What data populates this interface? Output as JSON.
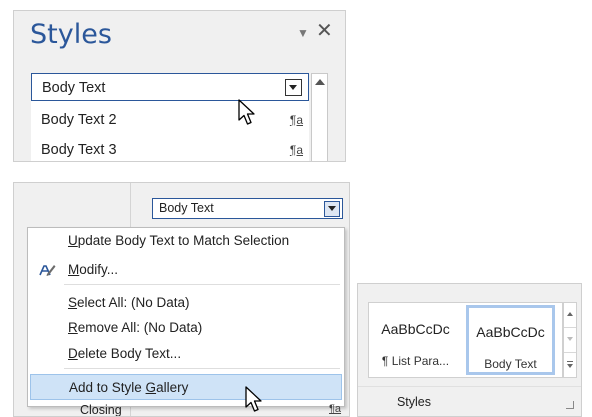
{
  "styles_pane": {
    "title": "Styles",
    "dropdown_glyph": "▼",
    "close_glyph": "✕",
    "items": [
      {
        "label": "Body Text",
        "mark": ""
      },
      {
        "label": "Body Text 2",
        "mark": "¶a"
      },
      {
        "label": "Body Text 3",
        "mark": "¶a"
      }
    ]
  },
  "context": {
    "combo_value": "Body Text",
    "menu": [
      {
        "pre": "",
        "u": "U",
        "post": "pdate Body Text to Match Selection"
      },
      {
        "pre": "",
        "u": "M",
        "post": "odify..."
      },
      {
        "pre": "",
        "u": "S",
        "post": "elect All: (No Data)"
      },
      {
        "pre": "",
        "u": "R",
        "post": "emove All: (No Data)"
      },
      {
        "pre": "",
        "u": "D",
        "post": "elete Body Text..."
      },
      {
        "pre": "Add to Style ",
        "u": "G",
        "post": "allery"
      }
    ],
    "below_item": "Closing",
    "below_mark": "¶a"
  },
  "gallery": {
    "items": [
      {
        "sample": "AaBbCcDc",
        "name": "¶ List Para..."
      },
      {
        "sample": "AaBbCcDc",
        "name": "Body Text"
      }
    ],
    "group_label": "Styles"
  },
  "colors": {
    "accent": "#2b579a",
    "highlight": "#cfe3f7",
    "selected_border": "#a9c7ec"
  },
  "icons": [
    "dropdown-arrow-icon",
    "close-icon",
    "pilcrow-a-icon",
    "scroll-up-icon",
    "mouse-pointer-icon",
    "modify-style-icon",
    "dialog-launcher-icon"
  ]
}
